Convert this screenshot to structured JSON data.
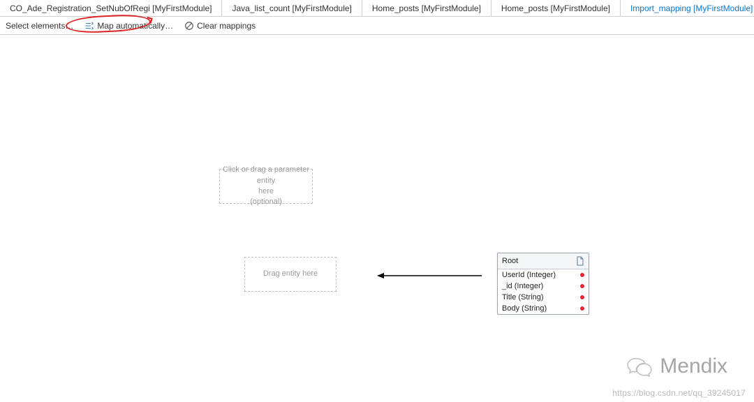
{
  "tabs": [
    {
      "label": "CO_Ade_Registration_SetNubOfRegi [MyFirstModule]",
      "active": false
    },
    {
      "label": "Java_list_count [MyFirstModule]",
      "active": false
    },
    {
      "label": "Home_posts [MyFirstModule]",
      "active": false
    },
    {
      "label": "Home_posts [MyFirstModule]",
      "active": false
    },
    {
      "label": "Import_mapping [MyFirstModule]",
      "active": true,
      "dirty": true,
      "closable": true
    }
  ],
  "toolbar": {
    "select_elements": "Select elements…",
    "map_auto": "Map automatically…",
    "clear": "Clear mappings"
  },
  "dropzones": {
    "param_line1": "Click or drag a parameter entity",
    "param_line2": "here",
    "param_line3": "(optional)",
    "entity": "Drag entity here"
  },
  "root": {
    "title": "Root",
    "fields": [
      {
        "name": "UserId (Integer)"
      },
      {
        "name": "_id (Integer)"
      },
      {
        "name": "Title (String)"
      },
      {
        "name": "Body (String)"
      }
    ]
  },
  "watermark": {
    "brand": "Mendix",
    "url": "https://blog.csdn.net/qq_39245017"
  }
}
